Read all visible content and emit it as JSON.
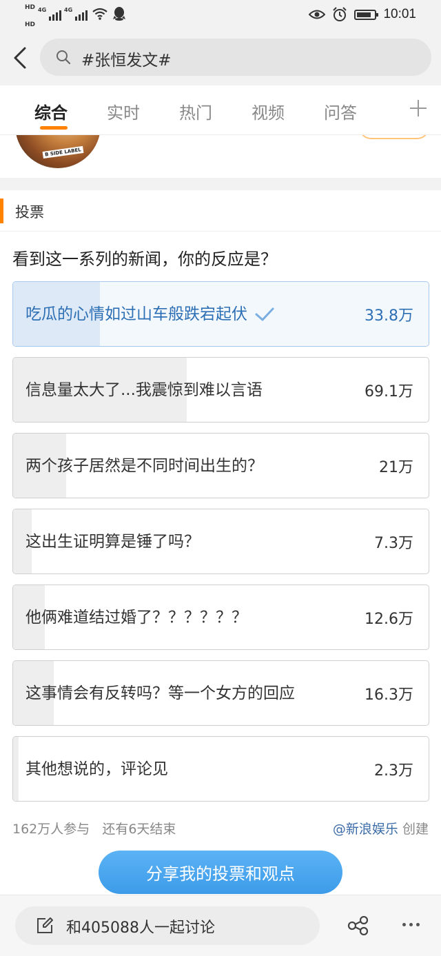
{
  "status_bar": {
    "hd1": "HD",
    "hd2": "HD",
    "network1": "4G",
    "network2": "4G",
    "time": "10:01",
    "icons": [
      "signal-icon",
      "wifi-icon",
      "qq-icon",
      "eye-icon",
      "alarm-icon",
      "battery-icon"
    ]
  },
  "search": {
    "query": "#张恒发文#"
  },
  "tabs": [
    {
      "label": "综合",
      "active": true
    },
    {
      "label": "实时",
      "active": false
    },
    {
      "label": "热门",
      "active": false
    },
    {
      "label": "视频",
      "active": false
    },
    {
      "label": "问答",
      "active": false
    }
  ],
  "prev_card": {
    "avatar_label": "B SIDE LABEL"
  },
  "vote": {
    "section_title": "投票",
    "question": "看到这一系列的新闻，你的反应是？",
    "options": [
      {
        "text": "吃瓜的心情如过山车般跌宕起伏",
        "count": "33.8万",
        "share": 0.209,
        "selected": true
      },
      {
        "text": "信息量太大了...我震惊到难以言语",
        "count": "69.1万",
        "share": 0.418,
        "selected": false
      },
      {
        "text": "两个孩子居然是不同时间出生的？",
        "count": "21万",
        "share": 0.127,
        "selected": false
      },
      {
        "text": "这出生证明算是锤了吗？",
        "count": "7.3万",
        "share": 0.044,
        "selected": false
      },
      {
        "text": "他俩难道结过婚了？？？？？？",
        "count": "12.6万",
        "share": 0.076,
        "selected": false
      },
      {
        "text": "这事情会有反转吗？等一个女方的回应",
        "count": "16.3万",
        "share": 0.098,
        "selected": false
      },
      {
        "text": "其他想说的，评论见",
        "count": "2.3万",
        "share": 0.014,
        "selected": false
      }
    ],
    "participants": "162万人参与",
    "remaining": "还有6天结束",
    "creator_link": "@新浪娱乐",
    "creator_suffix": "创建",
    "share_button": "分享我的投票和观点"
  },
  "bottom_bar": {
    "discuss_text": "和405088人一起讨论"
  },
  "colors": {
    "accent_orange": "#ff8200",
    "selected_blue": "#2d6fb4",
    "share_button_blue": "#3c9be8"
  }
}
